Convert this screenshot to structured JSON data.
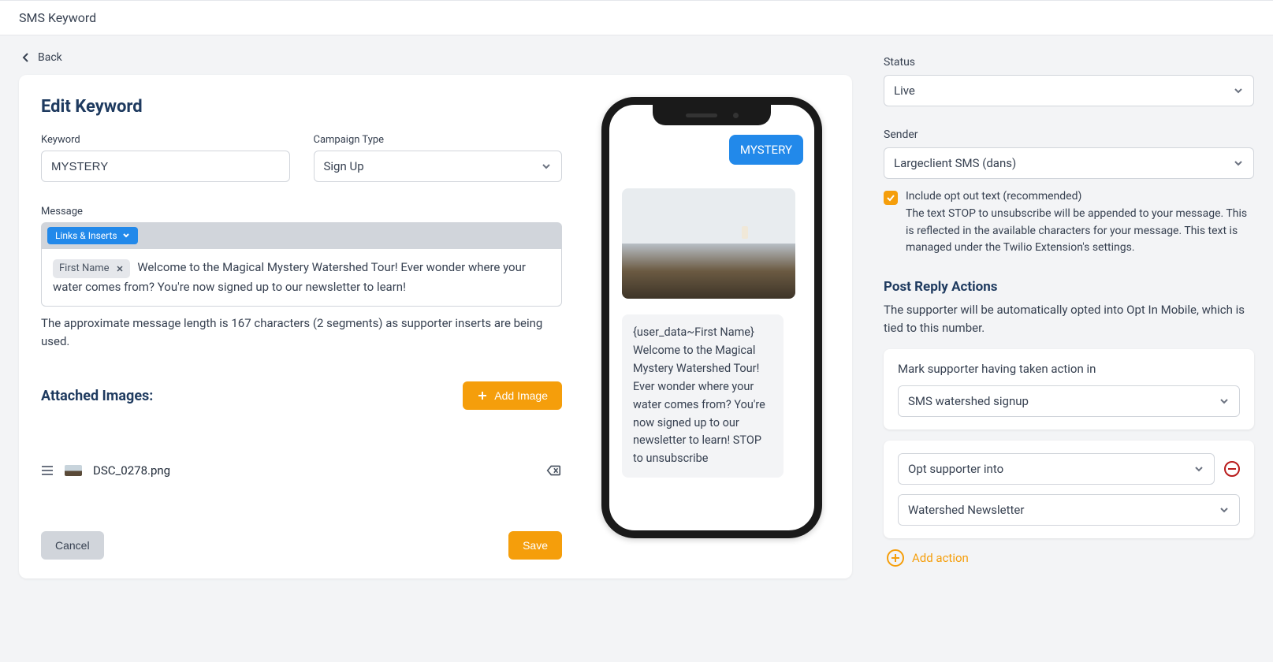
{
  "header": {
    "title": "SMS Keyword"
  },
  "nav": {
    "back": "Back"
  },
  "edit": {
    "title": "Edit Keyword",
    "keyword_label": "Keyword",
    "keyword_value": "MYSTERY",
    "campaign_label": "Campaign Type",
    "campaign_value": "Sign Up",
    "message_label": "Message",
    "links_btn": "Links & Inserts",
    "chip": "First Name",
    "message_text": "Welcome to the Magical Mystery Watershed Tour! Ever wonder where your water comes from? You're now signed up to our newsletter to learn!",
    "helper": "The approximate message length is 167 characters (2 segments) as supporter inserts are being used.",
    "images_heading": "Attached Images:",
    "add_image": "Add Image",
    "image_filename": "DSC_0278.png",
    "cancel": "Cancel",
    "save": "Save"
  },
  "preview": {
    "outgoing": "MYSTERY",
    "incoming": "{user_data~First Name} Welcome to the Magical Mystery Watershed Tour! Ever wonder where your water comes from? You're now signed up to our newsletter to learn! STOP to unsubscribe"
  },
  "side": {
    "status_label": "Status",
    "status_value": "Live",
    "sender_label": "Sender",
    "sender_value": "Largeclient SMS (dans)",
    "optout_label": "Include opt out text (recommended)",
    "optout_desc": "The text STOP to unsubscribe will be appended to your message. This is reflected in the available characters for your message. This text is managed under the Twilio Extension's settings.",
    "post_heading": "Post Reply Actions",
    "post_desc": "The supporter will be automatically opted into Opt In Mobile, which is tied to this number.",
    "action1_label": "Mark supporter having taken action in",
    "action1_value": "SMS watershed signup",
    "action2_type": "Opt supporter into",
    "action2_value": "Watershed Newsletter",
    "add_action": "Add action"
  }
}
